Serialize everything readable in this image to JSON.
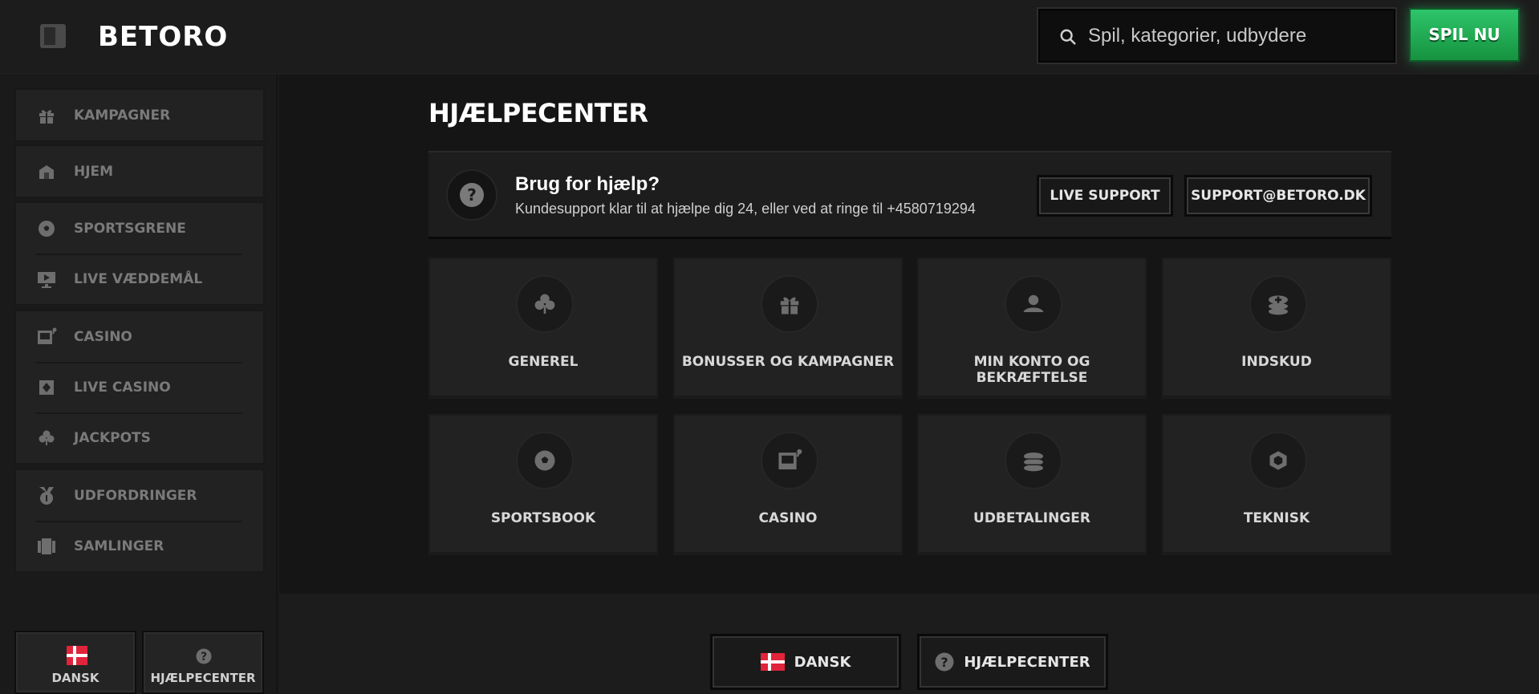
{
  "header": {
    "logo": "BETORO",
    "search_placeholder": "Spil, kategorier, udbydere",
    "play_label": "SPIL NU"
  },
  "sidebar": {
    "items": [
      {
        "label": "KAMPAGNER",
        "icon": "gift-icon"
      },
      {
        "label": "HJEM",
        "icon": "home-icon"
      },
      {
        "label": "SPORTSGRENE",
        "icon": "soccer-ball-icon"
      },
      {
        "label": "LIVE VÆDDEMÅL",
        "icon": "live-tv-icon"
      },
      {
        "label": "CASINO",
        "icon": "slot-machine-icon"
      },
      {
        "label": "LIVE CASINO",
        "icon": "card-icon"
      },
      {
        "label": "JACKPOTS",
        "icon": "clover-icon"
      },
      {
        "label": "UDFORDRINGER",
        "icon": "medal-icon"
      },
      {
        "label": "SAMLINGER",
        "icon": "collection-icon"
      }
    ],
    "language_label": "DANSK",
    "help_label": "HJÆLPECENTER"
  },
  "main": {
    "title": "HJÆLPECENTER",
    "help": {
      "title": "Brug for hjælp?",
      "subtitle": "Kundesupport klar til at hjælpe dig 24, eller ved at ringe til +4580719294",
      "live_support": "LIVE SUPPORT",
      "email": "SUPPORT@BETORO.DK"
    },
    "categories": [
      {
        "label": "GENEREL",
        "icon": "clover-icon"
      },
      {
        "label": "BONUSSER OG KAMPAGNER",
        "icon": "gift-icon"
      },
      {
        "label": "MIN KONTO OG BEKRÆFTELSE",
        "icon": "user-icon"
      },
      {
        "label": "INDSKUD",
        "icon": "coins-plus-icon"
      },
      {
        "label": "SPORTSBOOK",
        "icon": "soccer-ball-icon"
      },
      {
        "label": "CASINO",
        "icon": "slot-machine-icon"
      },
      {
        "label": "UDBETALINGER",
        "icon": "coins-stack-icon"
      },
      {
        "label": "TEKNISK",
        "icon": "hexagon-icon"
      }
    ]
  },
  "footer": {
    "language": "DANSK",
    "help": "HJÆLPECENTER"
  },
  "colors": {
    "accent_green": "#2ec56a",
    "background": "#1a1a1a",
    "flag_red": "#e0243a"
  }
}
